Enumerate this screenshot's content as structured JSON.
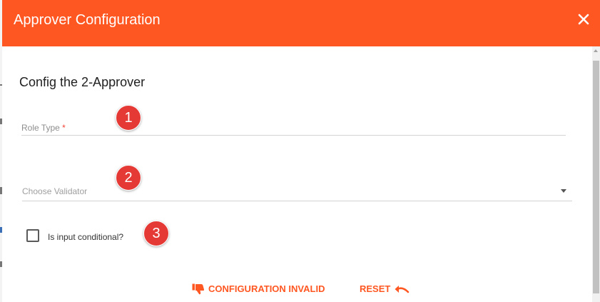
{
  "dialog": {
    "title": "Approver Configuration",
    "close_icon": "close-icon"
  },
  "section": {
    "title": "Config the 2-Approver"
  },
  "fields": {
    "role_type": {
      "label": "Role Type",
      "required_marker": "*",
      "value": ""
    },
    "validator": {
      "placeholder": "Choose Validator",
      "value": ""
    },
    "conditional": {
      "label": "Is input conditional?",
      "checked": false
    }
  },
  "badges": [
    "1",
    "2",
    "3"
  ],
  "actions": {
    "status_label": "CONFIGURATION INVALID",
    "status_icon": "thumbs-down-icon",
    "reset_label": "RESET",
    "reset_icon": "undo-icon"
  },
  "colors": {
    "accent": "#ff5722",
    "badge": "#e53935",
    "required": "#f44336"
  }
}
